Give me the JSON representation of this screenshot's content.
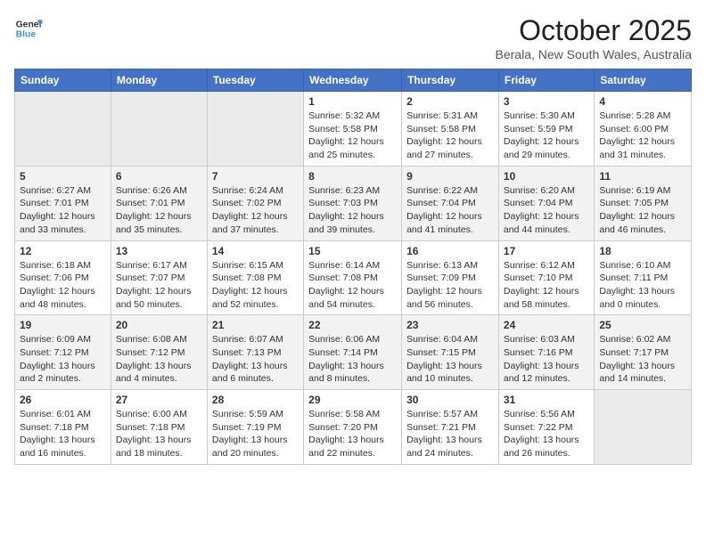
{
  "header": {
    "logo_line1": "General",
    "logo_line2": "Blue",
    "month": "October 2025",
    "location": "Berala, New South Wales, Australia"
  },
  "days_of_week": [
    "Sunday",
    "Monday",
    "Tuesday",
    "Wednesday",
    "Thursday",
    "Friday",
    "Saturday"
  ],
  "weeks": [
    [
      {
        "day": "",
        "info": ""
      },
      {
        "day": "",
        "info": ""
      },
      {
        "day": "",
        "info": ""
      },
      {
        "day": "1",
        "info": "Sunrise: 5:32 AM\nSunset: 5:58 PM\nDaylight: 12 hours\nand 25 minutes."
      },
      {
        "day": "2",
        "info": "Sunrise: 5:31 AM\nSunset: 5:58 PM\nDaylight: 12 hours\nand 27 minutes."
      },
      {
        "day": "3",
        "info": "Sunrise: 5:30 AM\nSunset: 5:59 PM\nDaylight: 12 hours\nand 29 minutes."
      },
      {
        "day": "4",
        "info": "Sunrise: 5:28 AM\nSunset: 6:00 PM\nDaylight: 12 hours\nand 31 minutes."
      }
    ],
    [
      {
        "day": "5",
        "info": "Sunrise: 6:27 AM\nSunset: 7:01 PM\nDaylight: 12 hours\nand 33 minutes."
      },
      {
        "day": "6",
        "info": "Sunrise: 6:26 AM\nSunset: 7:01 PM\nDaylight: 12 hours\nand 35 minutes."
      },
      {
        "day": "7",
        "info": "Sunrise: 6:24 AM\nSunset: 7:02 PM\nDaylight: 12 hours\nand 37 minutes."
      },
      {
        "day": "8",
        "info": "Sunrise: 6:23 AM\nSunset: 7:03 PM\nDaylight: 12 hours\nand 39 minutes."
      },
      {
        "day": "9",
        "info": "Sunrise: 6:22 AM\nSunset: 7:04 PM\nDaylight: 12 hours\nand 41 minutes."
      },
      {
        "day": "10",
        "info": "Sunrise: 6:20 AM\nSunset: 7:04 PM\nDaylight: 12 hours\nand 44 minutes."
      },
      {
        "day": "11",
        "info": "Sunrise: 6:19 AM\nSunset: 7:05 PM\nDaylight: 12 hours\nand 46 minutes."
      }
    ],
    [
      {
        "day": "12",
        "info": "Sunrise: 6:18 AM\nSunset: 7:06 PM\nDaylight: 12 hours\nand 48 minutes."
      },
      {
        "day": "13",
        "info": "Sunrise: 6:17 AM\nSunset: 7:07 PM\nDaylight: 12 hours\nand 50 minutes."
      },
      {
        "day": "14",
        "info": "Sunrise: 6:15 AM\nSunset: 7:08 PM\nDaylight: 12 hours\nand 52 minutes."
      },
      {
        "day": "15",
        "info": "Sunrise: 6:14 AM\nSunset: 7:08 PM\nDaylight: 12 hours\nand 54 minutes."
      },
      {
        "day": "16",
        "info": "Sunrise: 6:13 AM\nSunset: 7:09 PM\nDaylight: 12 hours\nand 56 minutes."
      },
      {
        "day": "17",
        "info": "Sunrise: 6:12 AM\nSunset: 7:10 PM\nDaylight: 12 hours\nand 58 minutes."
      },
      {
        "day": "18",
        "info": "Sunrise: 6:10 AM\nSunset: 7:11 PM\nDaylight: 13 hours\nand 0 minutes."
      }
    ],
    [
      {
        "day": "19",
        "info": "Sunrise: 6:09 AM\nSunset: 7:12 PM\nDaylight: 13 hours\nand 2 minutes."
      },
      {
        "day": "20",
        "info": "Sunrise: 6:08 AM\nSunset: 7:12 PM\nDaylight: 13 hours\nand 4 minutes."
      },
      {
        "day": "21",
        "info": "Sunrise: 6:07 AM\nSunset: 7:13 PM\nDaylight: 13 hours\nand 6 minutes."
      },
      {
        "day": "22",
        "info": "Sunrise: 6:06 AM\nSunset: 7:14 PM\nDaylight: 13 hours\nand 8 minutes."
      },
      {
        "day": "23",
        "info": "Sunrise: 6:04 AM\nSunset: 7:15 PM\nDaylight: 13 hours\nand 10 minutes."
      },
      {
        "day": "24",
        "info": "Sunrise: 6:03 AM\nSunset: 7:16 PM\nDaylight: 13 hours\nand 12 minutes."
      },
      {
        "day": "25",
        "info": "Sunrise: 6:02 AM\nSunset: 7:17 PM\nDaylight: 13 hours\nand 14 minutes."
      }
    ],
    [
      {
        "day": "26",
        "info": "Sunrise: 6:01 AM\nSunset: 7:18 PM\nDaylight: 13 hours\nand 16 minutes."
      },
      {
        "day": "27",
        "info": "Sunrise: 6:00 AM\nSunset: 7:18 PM\nDaylight: 13 hours\nand 18 minutes."
      },
      {
        "day": "28",
        "info": "Sunrise: 5:59 AM\nSunset: 7:19 PM\nDaylight: 13 hours\nand 20 minutes."
      },
      {
        "day": "29",
        "info": "Sunrise: 5:58 AM\nSunset: 7:20 PM\nDaylight: 13 hours\nand 22 minutes."
      },
      {
        "day": "30",
        "info": "Sunrise: 5:57 AM\nSunset: 7:21 PM\nDaylight: 13 hours\nand 24 minutes."
      },
      {
        "day": "31",
        "info": "Sunrise: 5:56 AM\nSunset: 7:22 PM\nDaylight: 13 hours\nand 26 minutes."
      },
      {
        "day": "",
        "info": ""
      }
    ]
  ]
}
